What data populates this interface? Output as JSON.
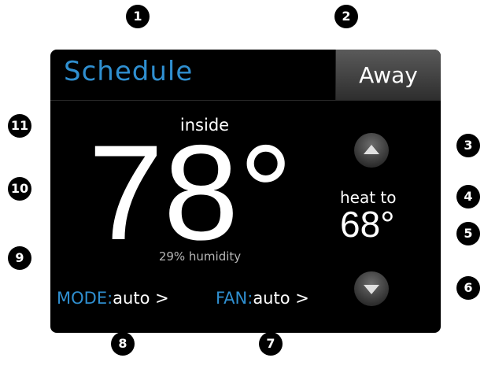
{
  "header": {
    "title": "Schedule",
    "away_label": "Away"
  },
  "main": {
    "inside_label": "inside",
    "current_temp": "78°",
    "humidity": "29% humidity",
    "mode_label": "MODE:",
    "mode_value": "auto >",
    "fan_label": "FAN:",
    "fan_value": "auto >"
  },
  "setpoint": {
    "label": "heat to",
    "value": "68°",
    "up_icon": "triangle-up-icon",
    "down_icon": "triangle-down-icon"
  },
  "callouts": [
    "1",
    "2",
    "3",
    "4",
    "5",
    "6",
    "7",
    "8",
    "9",
    "10",
    "11"
  ],
  "colors": {
    "accent": "#2f8fd0",
    "screen_bg": "#000000",
    "text": "#ffffff",
    "humidity_text": "#b7b7b7"
  }
}
